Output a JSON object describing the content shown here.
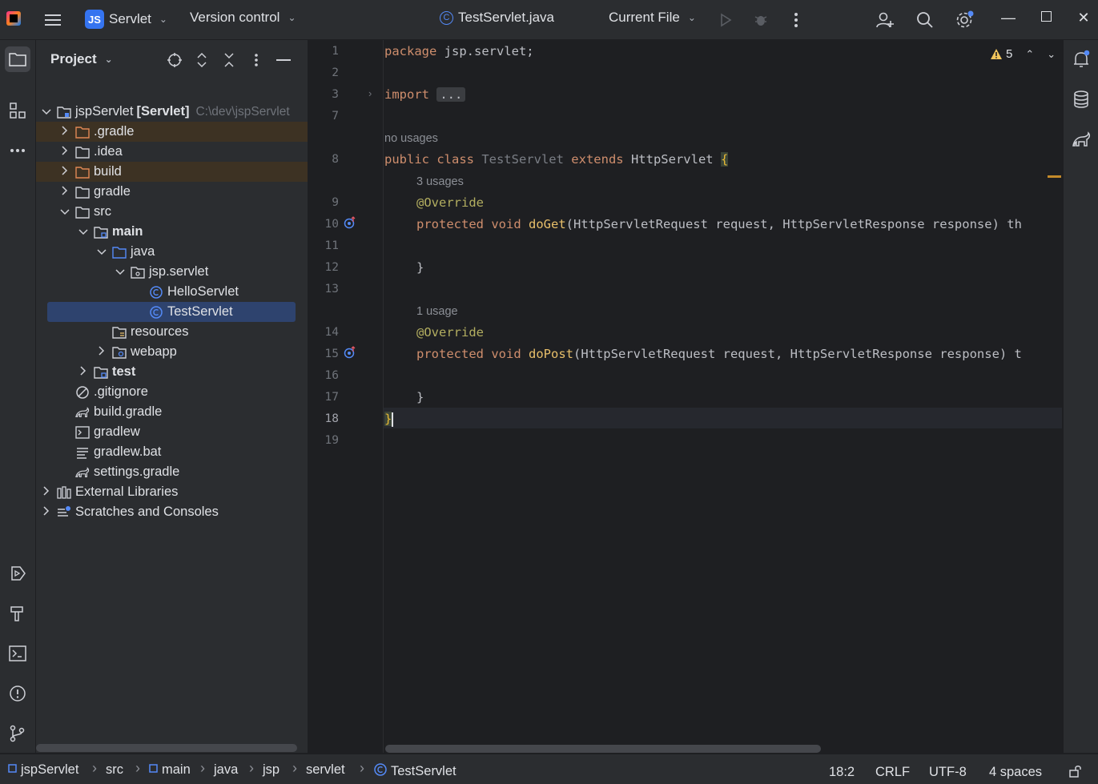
{
  "titlebar": {
    "menu_icon": "hamburger-icon",
    "project_badge": "JS",
    "project_name": "Servlet",
    "version_control": "Version control",
    "file_tab": "TestServlet.java",
    "run_config": "Current File"
  },
  "project_panel": {
    "title": "Project",
    "tree": [
      {
        "label": "jspServlet",
        "suffix": "[Servlet]",
        "hint": "C:\\dev\\jspServlet",
        "depth": 0,
        "arrow": "open",
        "icon": "module"
      },
      {
        "label": ".gradle",
        "depth": 1,
        "arrow": "closed",
        "icon": "folder-excluded",
        "excluded": true
      },
      {
        "label": ".idea",
        "depth": 1,
        "arrow": "closed",
        "icon": "folder"
      },
      {
        "label": "build",
        "depth": 1,
        "arrow": "closed",
        "icon": "folder-excluded",
        "excluded": true
      },
      {
        "label": "gradle",
        "depth": 1,
        "arrow": "closed",
        "icon": "folder"
      },
      {
        "label": "src",
        "depth": 1,
        "arrow": "open",
        "icon": "folder"
      },
      {
        "label": "main",
        "depth": 2,
        "arrow": "open",
        "icon": "source-root",
        "bold": true
      },
      {
        "label": "java",
        "depth": 3,
        "arrow": "open",
        "icon": "folder-blue"
      },
      {
        "label": "jsp.servlet",
        "depth": 4,
        "arrow": "open",
        "icon": "package"
      },
      {
        "label": "HelloServlet",
        "depth": 5,
        "arrow": "none",
        "icon": "class"
      },
      {
        "label": "TestServlet",
        "depth": 5,
        "arrow": "none",
        "icon": "class",
        "selected": true
      },
      {
        "label": "resources",
        "depth": 3,
        "arrow": "none",
        "icon": "resources"
      },
      {
        "label": "webapp",
        "depth": 3,
        "arrow": "closed",
        "icon": "web"
      },
      {
        "label": "test",
        "depth": 2,
        "arrow": "closed",
        "icon": "source-root",
        "bold": true
      },
      {
        "label": ".gitignore",
        "depth": 1,
        "arrow": "none",
        "icon": "ignore"
      },
      {
        "label": "build.gradle",
        "depth": 1,
        "arrow": "none",
        "icon": "gradle"
      },
      {
        "label": "gradlew",
        "depth": 1,
        "arrow": "none",
        "icon": "terminal"
      },
      {
        "label": "gradlew.bat",
        "depth": 1,
        "arrow": "none",
        "icon": "text"
      },
      {
        "label": "settings.gradle",
        "depth": 1,
        "arrow": "none",
        "icon": "gradle"
      },
      {
        "label": "External Libraries",
        "depth": 0,
        "arrow": "closed",
        "icon": "library"
      },
      {
        "label": "Scratches and Consoles",
        "depth": 0,
        "arrow": "closed",
        "icon": "scratches"
      }
    ]
  },
  "editor": {
    "warnings_count": "5",
    "line_numbers": [
      "1",
      "2",
      "3",
      "7",
      "8",
      "9",
      "10",
      "11",
      "12",
      "13",
      "14",
      "15",
      "16",
      "17",
      "18",
      "19"
    ],
    "current_line": "18",
    "hints": {
      "no_usages": "no usages",
      "three_usages": "3 usages",
      "one_usage": "1 usage"
    },
    "code": {
      "l1_kw": "package",
      "l1_rest": " jsp.servlet;",
      "l3_kw": "import",
      "l3_dots": "...",
      "l8_a": "public class",
      "l8_name": " TestServlet",
      "l8_ext": " extends",
      "l8_parent": " HttpServlet ",
      "l8_brace": "{",
      "l9": "@Override",
      "l10_kw": "protected void",
      "l10_fn": " doGet",
      "l10_args": "(HttpServletRequest request, HttpServletResponse response) th",
      "l12": "}",
      "l14": "@Override",
      "l15_kw": "protected void",
      "l15_fn": " doPost",
      "l15_args": "(HttpServletRequest request, HttpServletResponse response) t",
      "l17": "}",
      "l18": "}"
    }
  },
  "statusbar": {
    "breadcrumbs": [
      "jspServlet",
      "src",
      "main",
      "java",
      "jsp",
      "servlet",
      "TestServlet"
    ],
    "position": "18:2",
    "line_sep": "CRLF",
    "encoding": "UTF-8",
    "indent": "4 spaces"
  }
}
